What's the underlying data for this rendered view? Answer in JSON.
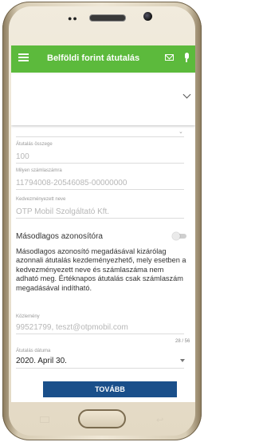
{
  "appbar": {
    "title": "Belföldi forint átutalás",
    "color": "#5cba3c"
  },
  "form": {
    "amount": {
      "label": "Átutalás összege",
      "value": "100"
    },
    "account": {
      "label": "Milyen számlaszámra",
      "value": "11794008-20546085-00000000"
    },
    "beneficiary": {
      "label": "Kedvezményezett neve",
      "value": "OTP Mobil Szolgáltató Kft."
    },
    "secondary_id": {
      "label": "Másodlagos azonosítóra",
      "enabled": false,
      "info": "Másodlagos azonosító megadásával kizárólag azonnali átutalás kezdeményezhető, mely esetben a kedvezményezett neve és számlaszáma nem adható meg. Értéknapos átutalás csak számlaszám megadásával indítható."
    },
    "message": {
      "label": "Közlemény",
      "value": "99521799, teszt@otpmobil.com",
      "counter": "28 / 56"
    },
    "date": {
      "label": "Átutalás dátuma",
      "value": "2020. April 30."
    }
  },
  "next_button": {
    "label": "TOVÁBB",
    "color": "#1a4f8a"
  },
  "icons": [
    "menu-icon",
    "mail-icon",
    "mic-icon",
    "chevron-down-icon"
  ]
}
